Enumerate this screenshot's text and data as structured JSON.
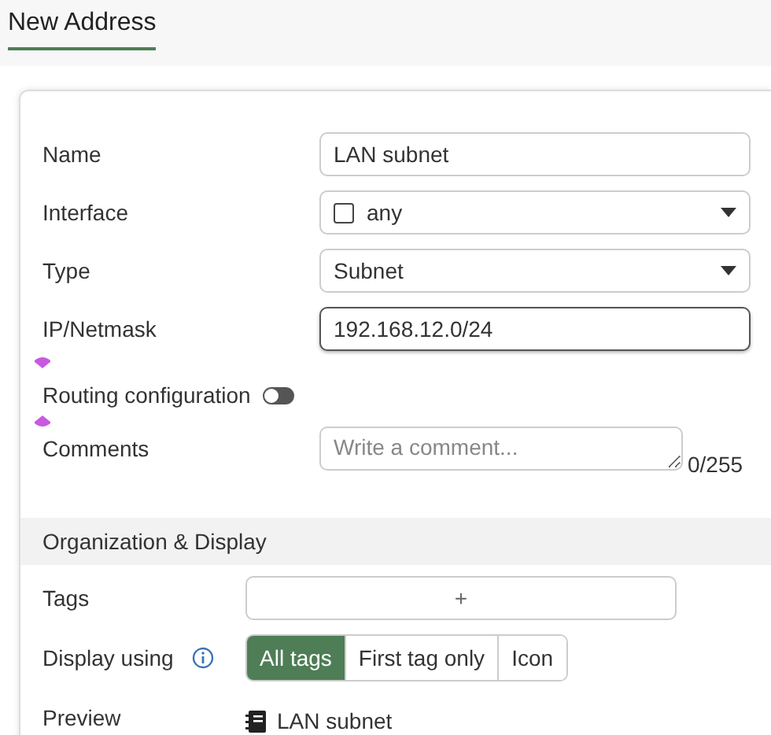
{
  "header": {
    "title": "New Address"
  },
  "fields": [
    {
      "kind": "text",
      "label": "Name",
      "value": "LAN subnet",
      "focused": false
    },
    {
      "kind": "icon-select",
      "label": "Interface",
      "value": "any"
    },
    {
      "kind": "select",
      "label": "Type",
      "value": "Subnet"
    },
    {
      "kind": "text",
      "label": "IP/Netmask",
      "value": "192.168.12.0/24",
      "focused": true
    },
    {
      "kind": "toggle",
      "label": "Routing configuration",
      "on": false
    },
    {
      "kind": "textarea",
      "label": "Comments",
      "placeholder": "Write a comment...",
      "counter": "0/255"
    }
  ],
  "section": {
    "title": "Organization & Display",
    "tags": {
      "label": "Tags",
      "add": "+"
    },
    "display": {
      "label": "Display using",
      "options": [
        {
          "label": "All tags",
          "selected": true
        },
        {
          "label": "First tag only",
          "selected": false
        },
        {
          "label": "Icon",
          "selected": false
        }
      ]
    },
    "preview": {
      "label": "Preview",
      "value": "LAN subnet"
    }
  }
}
